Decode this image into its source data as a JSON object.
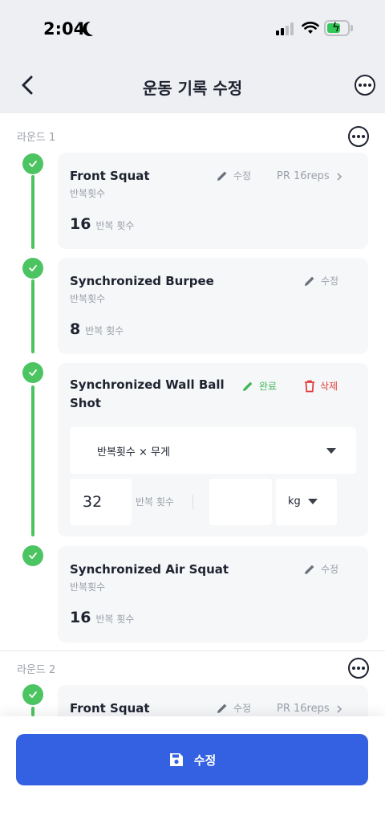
{
  "status": {
    "time": "2:04"
  },
  "header": {
    "title": "운동 기록 수정"
  },
  "rounds": [
    {
      "label": "라운드 1",
      "exercises": [
        {
          "name": "Front Squat",
          "subtitle": "반복횟수",
          "edit_label": "수정",
          "pr_label": "PR 16reps",
          "value": "16",
          "unit": "반복 횟수"
        },
        {
          "name": "Synchronized Burpee",
          "subtitle": "반복횟수",
          "edit_label": "수정",
          "value": "8",
          "unit": "반복 횟수"
        },
        {
          "name": "Synchronized Wall Ball",
          "name_line2": "Shot",
          "done_label": "완료",
          "delete_label": "삭제",
          "type_select": "반복횟수 × 무게",
          "reps_value": "32",
          "reps_unit": "반복 횟수",
          "weight_value": "",
          "weight_unit": "kg"
        },
        {
          "name": "Synchronized Air Squat",
          "subtitle": "반복횟수",
          "edit_label": "수정",
          "value": "16",
          "unit": "반복 횟수"
        }
      ]
    },
    {
      "label": "라운드 2",
      "exercises": [
        {
          "name": "Front Squat",
          "edit_label": "수정",
          "pr_label": "PR 16reps"
        }
      ]
    }
  ],
  "footer": {
    "save_label": "수정"
  },
  "colors": {
    "accent": "#3461e1",
    "success": "#4cc462",
    "danger": "#e0403c"
  }
}
